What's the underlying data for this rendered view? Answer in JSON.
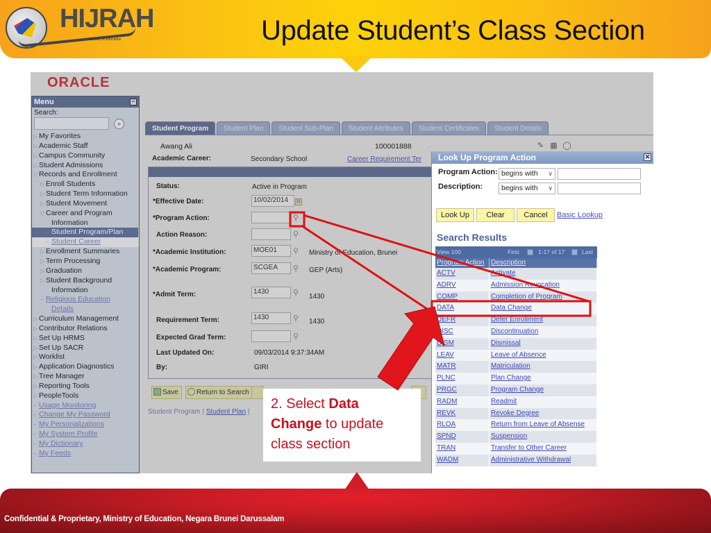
{
  "slide": {
    "title": "Update Student’s Class Section",
    "logo": {
      "text": "HIJRAH",
      "tm": "™",
      "sub": "Ministry of Education"
    },
    "footer": "Confidential & Proprietary, Ministry of Education, Negara Brunei Darussalam"
  },
  "app": {
    "brand": "ORACLE",
    "menu": {
      "title": "Menu",
      "collapse_icon": "−",
      "search_label": "Search:",
      "search_value": "",
      "go_icon": "»",
      "items": [
        {
          "label": "My Favorites",
          "level": 0,
          "type": "folder"
        },
        {
          "label": "Academic Staff",
          "level": 0,
          "type": "folder"
        },
        {
          "label": "Campus Community",
          "level": 0,
          "type": "folder"
        },
        {
          "label": "Student Admissions",
          "level": 0,
          "type": "folder"
        },
        {
          "label": "Records and Enrollment",
          "level": 0,
          "type": "open"
        },
        {
          "label": "Enroll Students",
          "level": 1,
          "type": "folder"
        },
        {
          "label": "Student Term Information",
          "level": 1,
          "type": "folder"
        },
        {
          "label": "Student Movement",
          "level": 1,
          "type": "folder"
        },
        {
          "label": "Career and Program",
          "level": 1,
          "type": "open"
        },
        {
          "label": "Information",
          "level": 1,
          "type": "cont"
        },
        {
          "label": "Student Program/Plan",
          "level": 2,
          "type": "selected"
        },
        {
          "label": "Student Career",
          "level": 2,
          "type": "link-selected"
        },
        {
          "label": "Enrollment Summaries",
          "level": 1,
          "type": "folder"
        },
        {
          "label": "Term Processing",
          "level": 1,
          "type": "folder"
        },
        {
          "label": "Graduation",
          "level": 1,
          "type": "folder"
        },
        {
          "label": "Student Background",
          "level": 1,
          "type": "folder"
        },
        {
          "label": "Information",
          "level": 1,
          "type": "cont"
        },
        {
          "label": "Religious Education",
          "level": 1,
          "type": "link"
        },
        {
          "label": "Details",
          "level": 1,
          "type": "link-cont"
        },
        {
          "label": "Curriculum Management",
          "level": 0,
          "type": "folder"
        },
        {
          "label": "Contributor Relations",
          "level": 0,
          "type": "folder"
        },
        {
          "label": "Set Up HRMS",
          "level": 0,
          "type": "folder"
        },
        {
          "label": "Set Up SACR",
          "level": 0,
          "type": "folder"
        },
        {
          "label": "Worklist",
          "level": 0,
          "type": "folder"
        },
        {
          "label": "Application Diagnostics",
          "level": 0,
          "type": "folder"
        },
        {
          "label": "Tree Manager",
          "level": 0,
          "type": "folder"
        },
        {
          "label": "Reporting Tools",
          "level": 0,
          "type": "folder"
        },
        {
          "label": "PeopleTools",
          "level": 0,
          "type": "folder"
        },
        {
          "label": "Usage Monitoring",
          "level": 0,
          "type": "link"
        },
        {
          "label": "Change My Password",
          "level": 0,
          "type": "link"
        },
        {
          "label": "My Personalizations",
          "level": 0,
          "type": "link"
        },
        {
          "label": "My System Profile",
          "level": 0,
          "type": "link"
        },
        {
          "label": "My Dictionary",
          "level": 0,
          "type": "link"
        },
        {
          "label": "My Feeds",
          "level": 0,
          "type": "link"
        }
      ]
    },
    "tabs": [
      {
        "label": "Student Program",
        "active": true
      },
      {
        "label": "Student Plan",
        "active": false
      },
      {
        "label": "Student Sub-Plan",
        "active": false
      },
      {
        "label": "Student Attributes",
        "active": false
      },
      {
        "label": "Student Certificates",
        "active": false
      },
      {
        "label": "Student Details",
        "active": false
      }
    ],
    "student": {
      "name": "Awang Ali",
      "id": "100001888",
      "career_label": "Academic Career:",
      "career_value": "Secondary School",
      "career_link": "Career Requirement Ter"
    },
    "header_icons": [
      "new-window-icon",
      "help-icon",
      "chat-icon"
    ],
    "form": {
      "status_label": "Status:",
      "status_value": "Active in Program",
      "effective_date_label": "*Effective Date:",
      "effective_date_value": "10/02/2014",
      "program_action_label": "*Program Action:",
      "program_action_value": "",
      "action_reason_label": "Action Reason:",
      "action_reason_value": "",
      "institution_label": "*Academic Institution:",
      "institution_value": "MOE01",
      "institution_desc": "Ministry of Education, Brunei",
      "program_label": "*Academic Program:",
      "program_value": "SCGEA",
      "program_desc": "GEP (Arts)",
      "admit_term_label": "*Admit Term:",
      "admit_term_value": "1430",
      "admit_term_desc": "1430",
      "req_term_label": "Requirement Term:",
      "req_term_value": "1430",
      "req_term_desc": "1430",
      "grad_term_label": "Expected Grad Term:",
      "grad_term_value": "",
      "last_updated_label": "Last Updated On:",
      "last_updated_value": "09/03/2014  9:37:34AM",
      "by_label": "By:",
      "by_value": "GIRI"
    },
    "toolbar": {
      "save": "Save",
      "return_to_search": "Return to Search"
    },
    "bottom_links": {
      "current": "Student Program",
      "sep": " | ",
      "plan": "Student Plan",
      "sep2": " |"
    }
  },
  "popup": {
    "title": "Look Up Program Action",
    "close_icon": "✕",
    "program_action_label": "Program Action:",
    "program_action_op": "begins with",
    "program_action_value": "",
    "description_label": "Description:",
    "description_op": "begins with",
    "description_value": "",
    "buttons": {
      "lookup": "Look Up",
      "clear": "Clear",
      "cancel": "Cancel"
    },
    "basic_lookup": "Basic Lookup",
    "results_title": "Search Results",
    "nav": {
      "view": "View 100",
      "first": "First",
      "range": "1-17 of 17",
      "last": "Last"
    },
    "columns": [
      "Program Action",
      "Description"
    ],
    "rows": [
      [
        "ACTV",
        "Activate"
      ],
      [
        "ADRV",
        "Admission Revocation"
      ],
      [
        "COMP",
        "Completion of Program"
      ],
      [
        "DATA",
        "Data Change"
      ],
      [
        "DEFR",
        "Defer Enrollment"
      ],
      [
        "DISC",
        "Discontinuation"
      ],
      [
        "DISM",
        "Dismissal"
      ],
      [
        "LEAV",
        "Leave of Absence"
      ],
      [
        "MATR",
        "Matriculation"
      ],
      [
        "PLNC",
        "Plan Change"
      ],
      [
        "PRGC",
        "Program Change"
      ],
      [
        "RADM",
        "Readmit"
      ],
      [
        "REVK",
        "Revoke Degree"
      ],
      [
        "RLOA",
        "Return from Leave of Absense"
      ],
      [
        "SPND",
        "Suspension"
      ],
      [
        "TRAN",
        "Transfer to Other Career"
      ],
      [
        "WADM",
        "Administrative Withdrawal"
      ]
    ],
    "highlighted_row": "DATA"
  },
  "callout": {
    "prefix": "2. Select ",
    "bold": "Data Change",
    "suffix": " to update class section",
    "color": "#c8101c"
  },
  "colors": {
    "annotation": "#e01010",
    "banner": "#fbc312",
    "footer": "#c61c25"
  }
}
